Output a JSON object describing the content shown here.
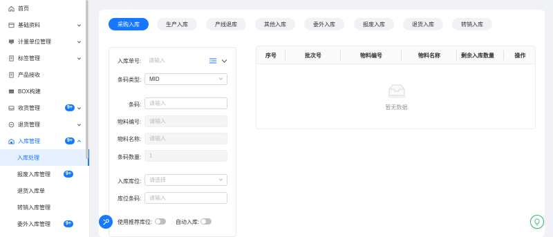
{
  "sidebar": {
    "items": [
      {
        "label": "首页",
        "icon": "home-icon"
      },
      {
        "label": "基础资料",
        "icon": "database-icon"
      },
      {
        "label": "计量单位管理",
        "icon": "monitor-icon"
      },
      {
        "label": "标签管理",
        "icon": "document-icon"
      },
      {
        "label": "产品接收",
        "icon": "document-icon"
      },
      {
        "label": "BOX构建",
        "icon": "box-icon"
      },
      {
        "label": "收货管理",
        "icon": "inbox-icon",
        "badge": "9+"
      },
      {
        "label": "退货管理",
        "icon": "return-icon"
      },
      {
        "label": "入库管理",
        "icon": "warehouse-icon",
        "badge": "9+"
      }
    ],
    "subitems": [
      {
        "label": "入库处理"
      },
      {
        "label": "报废入库管理",
        "badge": "9+"
      },
      {
        "label": "退货入库单"
      },
      {
        "label": "转销入库管理"
      },
      {
        "label": "委外入库管理",
        "badge": "9+"
      }
    ]
  },
  "tabs": [
    "采购入库",
    "生产入库",
    "产线退库",
    "其他入库",
    "委外入库",
    "报废入库",
    "退货入库",
    "转销入库"
  ],
  "form": {
    "order_no_label": "入库单号:",
    "order_no_placeholder": "请输入",
    "barcode_type_label": "条码类型:",
    "barcode_type_value": "MID",
    "barcode_label": "条码:",
    "barcode_placeholder": "请输入",
    "material_no_label": "物料编号:",
    "material_no_placeholder": "请输入",
    "material_name_label": "物料名称:",
    "material_name_placeholder": "请输入",
    "barcode_qty_label": "条码数量:",
    "barcode_qty_value": "1",
    "location_label": "入库库位:",
    "location_placeholder": "请选择",
    "location_barcode_label": "库位条码:",
    "location_barcode_placeholder": "请输入",
    "recommend_label": "使用推荐库位:",
    "auto_label": "自动入库:"
  },
  "table": {
    "columns": [
      "序号",
      "批次号",
      "物料编号",
      "物料名称",
      "剩余入库数量",
      "操作"
    ],
    "empty_text": "暂无数据"
  },
  "colors": {
    "accent": "#1677ff",
    "help_border": "#2fbf71"
  }
}
